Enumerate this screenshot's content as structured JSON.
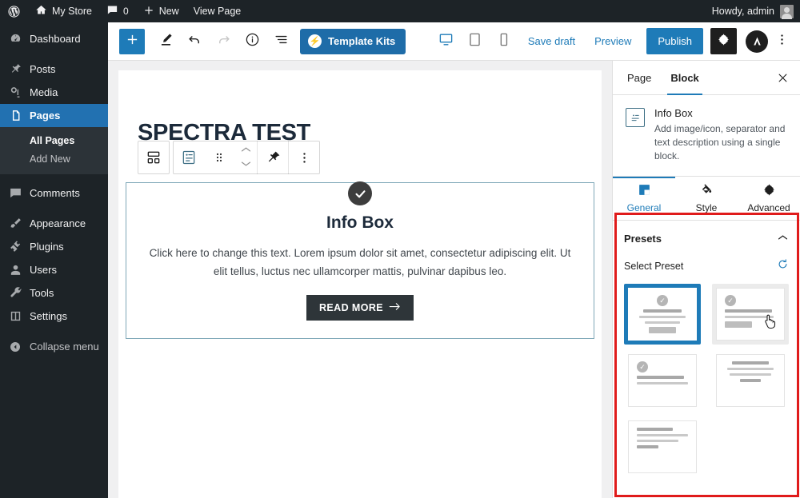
{
  "adminbar": {
    "logo_icon": "wordpress-logo-icon",
    "site_icon": "home-icon",
    "site_name": "My Store",
    "comments_icon": "comment-bubble-icon",
    "comments_count": "0",
    "new_icon": "plus-icon",
    "new_label": "New",
    "view_page_label": "View Page",
    "howdy": "Howdy, admin",
    "avatar_name": "avatar"
  },
  "adminmenu": {
    "items": [
      {
        "label": "Dashboard",
        "icon": "dashboard-icon",
        "current": false
      },
      {
        "label": "Posts",
        "icon": "pin-icon",
        "current": false
      },
      {
        "label": "Media",
        "icon": "media-icon",
        "current": false
      },
      {
        "label": "Pages",
        "icon": "pages-icon",
        "current": true
      },
      {
        "label": "Comments",
        "icon": "comment-icon",
        "current": false
      },
      {
        "label": "Appearance",
        "icon": "brush-icon",
        "current": false
      },
      {
        "label": "Plugins",
        "icon": "plug-icon",
        "current": false
      },
      {
        "label": "Users",
        "icon": "user-icon",
        "current": false
      },
      {
        "label": "Tools",
        "icon": "wrench-icon",
        "current": false
      },
      {
        "label": "Settings",
        "icon": "settings-sliders-icon",
        "current": false
      }
    ],
    "submenu": [
      {
        "label": "All Pages",
        "current": true
      },
      {
        "label": "Add New",
        "current": false
      }
    ],
    "collapse_label": "Collapse menu",
    "collapse_icon": "collapse-arrow-icon"
  },
  "editor_header": {
    "add_block_icon": "plus-icon",
    "tools_icon": "pencil-icon",
    "undo_icon": "undo-arrow-icon",
    "redo_icon": "redo-arrow-icon",
    "details_icon": "info-circle-icon",
    "list_view_icon": "list-view-icon",
    "template_kits_label": "Template Kits",
    "template_kits_icon": "bolt-icon",
    "devices": [
      {
        "name": "desktop-icon",
        "active": true
      },
      {
        "name": "tablet-icon",
        "active": false
      },
      {
        "name": "mobile-icon",
        "active": false
      }
    ],
    "save_draft_label": "Save draft",
    "preview_label": "Preview",
    "publish_label": "Publish",
    "settings_gear_icon": "gear-icon",
    "astra_icon": "astra-logo-icon",
    "options_icon": "vertical-dots-icon"
  },
  "canvas": {
    "page_title": "SPECTRA TEST",
    "block_toolbar": {
      "parent_icon": "parent-block-icon",
      "block_icon": "info-box-block-icon",
      "drag_icon": "drag-handle-icon",
      "move_up_icon": "chevron-up-icon",
      "move_down_icon": "chevron-down-icon",
      "tools_icon": "pin-tool-icon",
      "more_icon": "vertical-dots-icon"
    },
    "info_box": {
      "icon": "check-circle-icon",
      "title": "Info Box",
      "text": "Click here to change this text. Lorem ipsum dolor sit amet, consectetur adipiscing elit. Ut elit tellus, luctus nec ullamcorper mattis, pulvinar dapibus leo.",
      "cta_label": "READ MORE",
      "cta_arrow": "arrow-right-icon"
    }
  },
  "settings_sidebar": {
    "tabs": [
      {
        "label": "Page",
        "active": false
      },
      {
        "label": "Block",
        "active": true
      }
    ],
    "close_icon": "close-icon",
    "block": {
      "icon": "info-box-block-icon",
      "title": "Info Box",
      "description": "Add image/icon, separator and text description using a single block."
    },
    "mode_tabs": [
      {
        "label": "General",
        "icon": "general-layout-icon",
        "active": true
      },
      {
        "label": "Style",
        "icon": "paint-bucket-icon",
        "active": false
      },
      {
        "label": "Advanced",
        "icon": "gear-icon",
        "active": false
      }
    ],
    "presets": {
      "section_label": "Presets",
      "collapse_icon": "chevron-up-icon",
      "select_label": "Select Preset",
      "reset_icon": "reset-circular-arrow-icon",
      "items": [
        {
          "name": "preset-1",
          "layout": "center-icon-title-text-button",
          "state": "selected"
        },
        {
          "name": "preset-2",
          "layout": "left-icon-title-text-button",
          "state": "hover"
        },
        {
          "name": "preset-3",
          "layout": "left-icon-title-text",
          "state": "default"
        },
        {
          "name": "preset-4",
          "layout": "center-title-text",
          "state": "default"
        },
        {
          "name": "preset-5",
          "layout": "left-title-text",
          "state": "default"
        }
      ]
    }
  },
  "annotation": {
    "name": "red-highlight-box",
    "color": "#e01b1b"
  }
}
